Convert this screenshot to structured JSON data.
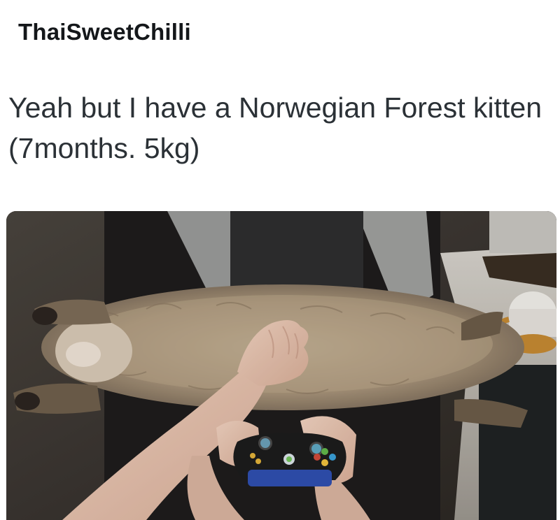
{
  "tweet": {
    "username": "ThaiSweetChilli",
    "text": "Yeah but I have a Norwegian Forest kitten (7months. 5kg)"
  },
  "media": {
    "alt": "fluffy kitten lying on lap with game controller"
  }
}
